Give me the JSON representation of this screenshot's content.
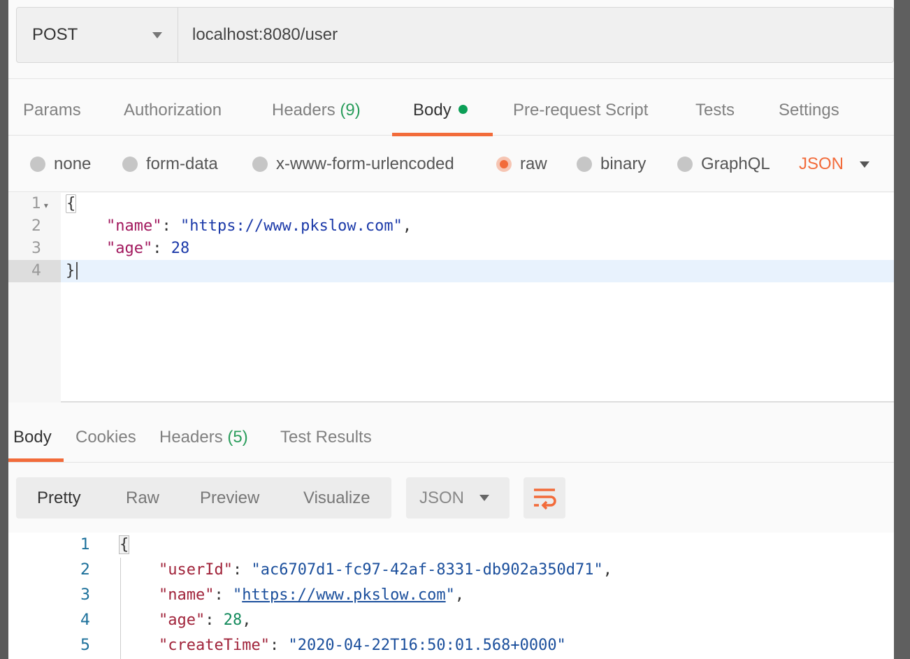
{
  "request": {
    "method": "POST",
    "url": "localhost:8080/user"
  },
  "tabs": [
    {
      "label": "Params"
    },
    {
      "label": "Authorization"
    },
    {
      "label": "Headers",
      "count": "(9)"
    },
    {
      "label": "Body",
      "active": true
    },
    {
      "label": "Pre-request Script"
    },
    {
      "label": "Tests"
    },
    {
      "label": "Settings"
    }
  ],
  "body_types": [
    "none",
    "form-data",
    "x-www-form-urlencoded",
    "raw",
    "binary",
    "GraphQL"
  ],
  "body_selected": "raw",
  "body_format": "JSON",
  "request_body": {
    "line_numbers": [
      "1",
      "2",
      "3",
      "4"
    ],
    "lines": [
      {
        "t": "{"
      },
      {
        "key": "\"name\"",
        "sep": ": ",
        "val": "\"https://www.pkslow.com\"",
        "end": ","
      },
      {
        "key": "\"age\"",
        "sep": ": ",
        "val": "28",
        "end": ""
      },
      {
        "t": "}"
      }
    ]
  },
  "response_tabs": [
    {
      "label": "Body",
      "active": true
    },
    {
      "label": "Cookies"
    },
    {
      "label": "Headers",
      "count": "(5)"
    },
    {
      "label": "Test Results"
    }
  ],
  "view_modes": [
    "Pretty",
    "Raw",
    "Preview",
    "Visualize"
  ],
  "response_format": "JSON",
  "wrap_icon": "wrap-lines-icon",
  "accent": "#f26b3a",
  "response_body": {
    "line_numbers": [
      "1",
      "2",
      "3",
      "4",
      "5"
    ],
    "lines": [
      {
        "t": "{"
      },
      {
        "key": "\"userId\"",
        "sep": ": ",
        "val": "\"ac6707d1-fc97-42af-8331-db902a350d71\"",
        "end": ","
      },
      {
        "key": "\"name\"",
        "sep": ": ",
        "q1": "\"",
        "link": "https://www.pkslow.com",
        "q2": "\"",
        "end": ","
      },
      {
        "key": "\"age\"",
        "sep": ": ",
        "val": "28",
        "end": ","
      },
      {
        "key": "\"createTime\"",
        "sep": ": ",
        "val": "\"2020-04-22T16:50:01.568+0000\"",
        "end": ""
      }
    ]
  }
}
